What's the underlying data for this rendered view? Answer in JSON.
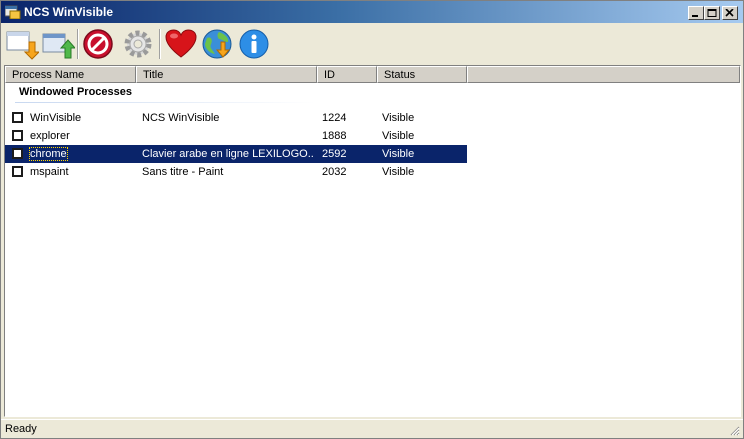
{
  "window": {
    "title": "NCS WinVisible"
  },
  "toolbar": {
    "buttons": [
      {
        "icon": "window-hide-icon"
      },
      {
        "icon": "window-show-icon"
      },
      {
        "icon": "stop-icon"
      },
      {
        "icon": "settings-gear-icon"
      },
      {
        "icon": "heart-icon"
      },
      {
        "icon": "update-globe-icon"
      },
      {
        "icon": "info-icon"
      }
    ]
  },
  "list": {
    "columns": [
      "Process Name",
      "Title",
      "ID",
      "Status"
    ],
    "group_label": "Windowed Processes",
    "rows": [
      {
        "name": "WinVisible",
        "title": "NCS WinVisible",
        "id": "1224",
        "status": "Visible",
        "checked": false,
        "selected": false
      },
      {
        "name": "explorer",
        "title": "",
        "id": "1888",
        "status": "Visible",
        "checked": false,
        "selected": false
      },
      {
        "name": "chrome",
        "title": "Clavier arabe en ligne LEXILOGO...",
        "id": "2592",
        "status": "Visible",
        "checked": false,
        "selected": true
      },
      {
        "name": "mspaint",
        "title": "Sans titre - Paint",
        "id": "2032",
        "status": "Visible",
        "checked": false,
        "selected": false
      }
    ]
  },
  "status": {
    "text": "Ready"
  },
  "colors": {
    "selection": "#0a246a",
    "titlebar_start": "#0a246a",
    "titlebar_end": "#a6caf0"
  }
}
